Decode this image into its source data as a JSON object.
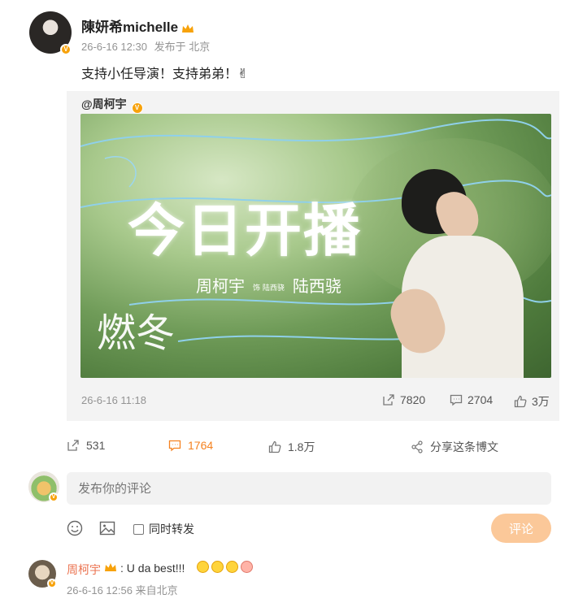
{
  "post": {
    "username": "陳妍希michelle",
    "date": "26-6-16 12:30",
    "source": "发布于 北京",
    "text": "支持小任导演！支持弟弟！✌"
  },
  "repost": {
    "username": "@周柯宇",
    "poster": {
      "title": "今日开播",
      "cast_left": "周柯宇",
      "cast_middle": "饰 陆西骁",
      "cast_right": "陆西骁",
      "logo": "燃冬"
    },
    "date": "26-6-16 11:18",
    "shares": "7820",
    "comments": "2704",
    "likes": "3万"
  },
  "actions": {
    "shares": "531",
    "comments": "1764",
    "likes": "1.8万",
    "share_label": "分享这条博文"
  },
  "comment_box": {
    "placeholder": "发布你的评论",
    "repost_label": "同时转发",
    "submit_label": "评论"
  },
  "comment": {
    "username": "周柯宇",
    "text": ": U da best!!!",
    "date": "26-6-16 12:56",
    "source": "来自北京"
  },
  "colors": {
    "accent": "#f58220",
    "vip_badge": "#f7a20b",
    "comment_name": "#eb7350",
    "submit_bg": "#fbc899"
  }
}
